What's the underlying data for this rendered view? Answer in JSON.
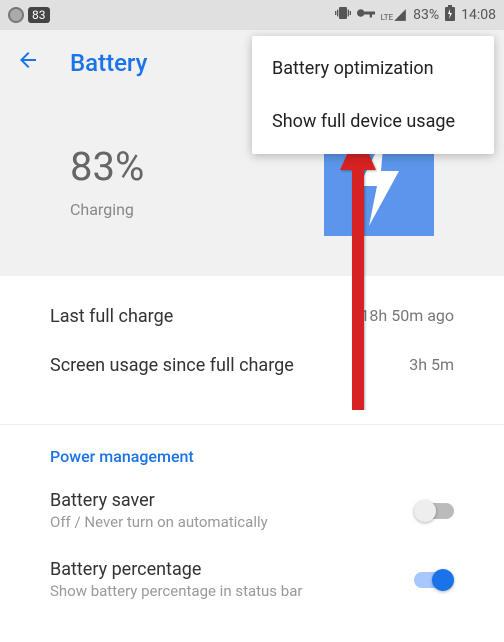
{
  "status_bar": {
    "badge": "83",
    "lte": "LTE",
    "battery_pct": "83%",
    "time": "14:08"
  },
  "app_bar": {
    "title": "Battery"
  },
  "summary": {
    "percent": "83%",
    "status": "Charging"
  },
  "stats": {
    "last_charge_label": "Last full charge",
    "last_charge_value": "18h 50m ago",
    "screen_label": "Screen usage since full charge",
    "screen_value": "3h 5m"
  },
  "power": {
    "header": "Power management",
    "saver_title": "Battery saver",
    "saver_sub": "Off / Never turn on automatically",
    "pct_title": "Battery percentage",
    "pct_sub": "Show battery percentage in status bar"
  },
  "menu": {
    "item1": "Battery optimization",
    "item2": "Show full device usage"
  }
}
